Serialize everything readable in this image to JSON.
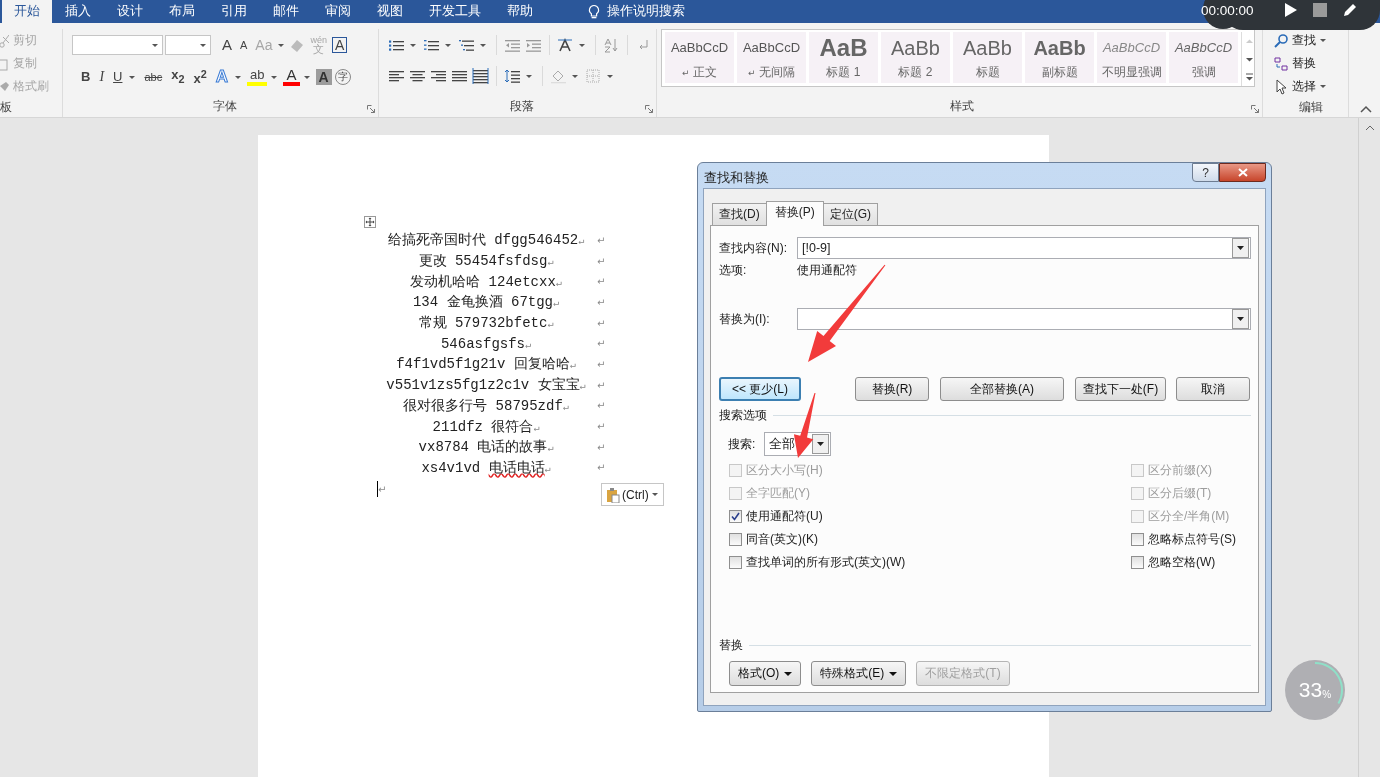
{
  "ribbon": {
    "tabs": [
      {
        "label": "开始",
        "selected": true
      },
      {
        "label": "插入",
        "selected": false
      },
      {
        "label": "设计",
        "selected": false
      },
      {
        "label": "布局",
        "selected": false
      },
      {
        "label": "引用",
        "selected": false
      },
      {
        "label": "邮件",
        "selected": false
      },
      {
        "label": "审阅",
        "selected": false
      },
      {
        "label": "视图",
        "selected": false
      },
      {
        "label": "开发工具",
        "selected": false
      },
      {
        "label": "帮助",
        "selected": false
      }
    ],
    "tell_me": "操作说明搜索",
    "clipboard": {
      "label": "板",
      "items": [
        {
          "kind": "cut",
          "label": "剪切",
          "disabled": true
        },
        {
          "kind": "copy",
          "label": "复制",
          "disabled": true
        },
        {
          "kind": "painter",
          "label": "格式刷",
          "disabled": true
        }
      ]
    },
    "font": {
      "label": "字体",
      "row_1": [
        {
          "kind": "grow",
          "label": "A",
          "disabled": false
        },
        {
          "kind": "shrink",
          "label": "A",
          "disabled": false
        },
        {
          "kind": "case",
          "label": "Aa",
          "disabled": true
        },
        {
          "kind": "clear",
          "disabled": true
        },
        {
          "kind": "phonetic",
          "label": "wén",
          "base": "文",
          "disabled": true
        },
        {
          "kind": "border",
          "label": "A",
          "disabled": false
        }
      ],
      "row_2": [
        {
          "kind": "bold",
          "label": "B"
        },
        {
          "kind": "italic",
          "label": "I"
        },
        {
          "kind": "underline",
          "label": "U"
        },
        {
          "kind": "strike",
          "label": "abc"
        },
        {
          "kind": "sub",
          "label": "x$_{2}$"
        },
        {
          "kind": "sup",
          "label": "x$^{2}$"
        },
        {
          "kind": "effect",
          "label": "A"
        },
        {
          "kind": "highlight",
          "label": "ab",
          "color": "#ffff00"
        },
        {
          "kind": "color",
          "label": "A",
          "color": "#ff0000"
        },
        {
          "kind": "shade",
          "label": "A"
        },
        {
          "kind": "enclose",
          "label": "字"
        }
      ]
    },
    "paragraph": {
      "label": "段落"
    },
    "styles": {
      "label": "样式",
      "items": [
        {
          "kind": "body",
          "preview": "AaBbCcD",
          "mark": "↵",
          "label": "正文"
        },
        {
          "kind": "body",
          "preview": "AaBbCcD",
          "mark": "↵",
          "label": "无间隔"
        },
        {
          "kind": "heading1",
          "preview": "AaB",
          "label": "标题 1"
        },
        {
          "kind": "heading2",
          "preview": "AaBb",
          "label": "标题 2"
        },
        {
          "kind": "title",
          "preview": "AaBb",
          "label": "标题"
        },
        {
          "kind": "subtitle",
          "preview": "AaBb",
          "label": "副标题"
        },
        {
          "kind": "subtle",
          "preview": "AaBbCcD",
          "label": "不明显强调"
        },
        {
          "kind": "emphasis",
          "preview": "AaBbCcD",
          "label": "强调"
        }
      ]
    },
    "editing": {
      "label": "编辑",
      "items": [
        {
          "kind": "find",
          "label": "查找",
          "menu": true
        },
        {
          "kind": "replace",
          "label": "替换",
          "menu": false
        },
        {
          "kind": "select",
          "label": "选择",
          "menu": true
        }
      ]
    }
  },
  "recorder": {
    "time": "00:00:00"
  },
  "document": {
    "lines": [
      {
        "text": "给搞死帝国时代 dfgg546452",
        "mark": "↵",
        "row_end": "↵"
      },
      {
        "text": "更改 55454fsfdsg",
        "mark": "↵",
        "row_end": "↵"
      },
      {
        "text": "发动机哈哈 124etcxx",
        "mark": "↵",
        "row_end": "↵"
      },
      {
        "text": "134 金龟换酒 67tgg",
        "mark": "↵",
        "row_end": "↵"
      },
      {
        "text": "常规 579732bfetc",
        "mark": "↵",
        "row_end": "↵"
      },
      {
        "text": "546asfgsfs",
        "mark": "↵",
        "row_end": "↵"
      },
      {
        "text": "f4f1vd5f1g21v 回复哈哈",
        "mark": "↵",
        "row_end": "↵"
      },
      {
        "text": "v551v1zs5fg1z2c1v 女宝宝",
        "mark": "↵",
        "row_end": "↵"
      },
      {
        "text": "很对很多行号 58795zdf",
        "mark": "↵",
        "row_end": "↵"
      },
      {
        "text": "211dfz 很符合",
        "mark": "↵",
        "row_end": "↵"
      },
      {
        "text": "vx8784 电话的故事",
        "mark": "↵",
        "row_end": "↵"
      },
      {
        "text": "xs4v1vd ",
        "misspelled": "电话电话",
        "mark": "↵",
        "row_end": "↵"
      }
    ],
    "cursor_line": {
      "mark": "↵"
    },
    "paste_options": {
      "label": "(Ctrl)"
    }
  },
  "dialog": {
    "title": "查找和替换",
    "help": "?",
    "tabs": [
      {
        "label": "查找(D)",
        "selected": false
      },
      {
        "label": "替换(P)",
        "selected": true
      },
      {
        "label": "定位(G)",
        "selected": false
      }
    ],
    "find": {
      "label": "查找内容(N):",
      "value": "[!0-9]"
    },
    "options": {
      "label": "选项:",
      "value": "使用通配符"
    },
    "replace": {
      "label": "替换为(I):"
    },
    "buttons": [
      {
        "label": "<< 更少(L)",
        "focused": true
      },
      {
        "label": "替换(R)",
        "focused": false
      },
      {
        "label": "全部替换(A)",
        "focused": false
      },
      {
        "label": "查找下一处(F)",
        "focused": false
      },
      {
        "label": "取消",
        "focused": false
      }
    ],
    "search_options": {
      "heading": "搜索选项",
      "search_label": "搜索:",
      "search_value": "全部",
      "left": [
        {
          "label": "区分大小写(H)",
          "checked": false,
          "disabled": true
        },
        {
          "label": "全字匹配(Y)",
          "checked": false,
          "disabled": true
        },
        {
          "label": "使用通配符(U)",
          "checked": true,
          "disabled": false
        },
        {
          "label": "同音(英文)(K)",
          "checked": false,
          "disabled": false
        },
        {
          "label": "查找单词的所有形式(英文)(W)",
          "checked": false,
          "disabled": false
        }
      ],
      "right": [
        {
          "label": "区分前缀(X)",
          "checked": false,
          "disabled": true
        },
        {
          "label": "区分后缀(T)",
          "checked": false,
          "disabled": true
        },
        {
          "label": "区分全/半角(M)",
          "checked": false,
          "disabled": true
        },
        {
          "label": "忽略标点符号(S)",
          "checked": false,
          "disabled": false
        },
        {
          "label": "忽略空格(W)",
          "checked": false,
          "disabled": false
        }
      ]
    },
    "replace_section": {
      "heading": "替换",
      "buttons": [
        {
          "label": "格式(O)",
          "menu": true,
          "disabled": false
        },
        {
          "label": "特殊格式(E)",
          "menu": true,
          "disabled": false
        },
        {
          "label": "不限定格式(T)",
          "menu": false,
          "disabled": true
        }
      ]
    }
  },
  "progress_widget": {
    "value": "33",
    "unit": "%"
  }
}
